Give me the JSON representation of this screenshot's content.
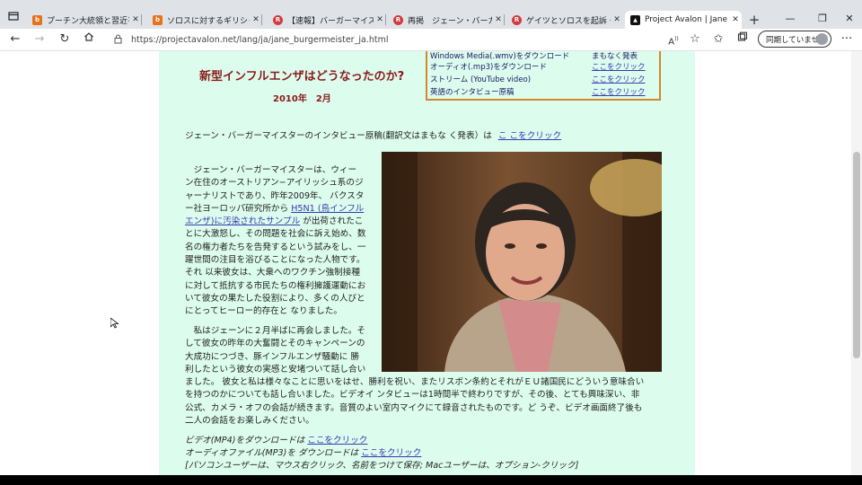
{
  "browser": {
    "tabs": [
      {
        "title": "プーチン大統領と習近平国家主",
        "favicon_color": "#e8711a",
        "favicon_glyph": "b"
      },
      {
        "title": "ソロスに対するギリシャ検察官の",
        "favicon_color": "#e8711a",
        "favicon_glyph": "b"
      },
      {
        "title": "【速報】バーガーマイスター、命取",
        "favicon_color": "#d33a3a",
        "favicon_glyph": "R"
      },
      {
        "title": "再掲　ジェーン・バーガーマイスタ",
        "favicon_color": "#d33a3a",
        "favicon_glyph": "R"
      },
      {
        "title": "ゲイツとソロスを起訴・有罪への",
        "favicon_color": "#d33a3a",
        "favicon_glyph": "R"
      },
      {
        "title": "Project Avalon | Jane Burger",
        "favicon_color": "#111111",
        "favicon_glyph": "▲"
      }
    ],
    "url": "https://projectavalon.net/lang/ja/jane_burgermeister_ja.html",
    "profile_label": "同期していません",
    "icons": [
      "tab-actions-icon",
      "back-icon",
      "forward-icon",
      "refresh-icon",
      "home-icon",
      "lock-icon",
      "read-aloud-icon",
      "favorite-add-icon",
      "favorites-icon",
      "collections-icon",
      "more-icon"
    ]
  },
  "page": {
    "headline": "新型インフルエンザはどうなったのか?",
    "date": "2010年　2月",
    "downloads": [
      {
        "label": "Windows Media(.wmv)をダウンロード",
        "action": "まもなく発表",
        "is_link": false
      },
      {
        "label": "オーディオ(.mp3)をダウンロード",
        "action": "ここをクリック",
        "is_link": true
      },
      {
        "label": "ストリーム (YouTube video)",
        "action": "ここをクリック",
        "is_link": true
      },
      {
        "label": "英語のインタビュー原稿",
        "action": "ここをクリック",
        "is_link": true
      }
    ],
    "transcript_line": "ジェーン・バーガーマイスターのインタビュー原稿(翻訳文はまもな く発表）は",
    "transcript_link": "こ こをクリック",
    "para1_lines": [
      "　ジェーン・バーガーマイスターは、ウィー",
      "ン在住のオーストリアン−アイリッシュ系のジ",
      "ャーナリストであり、昨年2009年、 バクスタ",
      "ー社ヨーロッパ研究所から"
    ],
    "para1_link_a": "H5N1 (鳥インフル",
    "para1_link_b": "エンザ)に汚染されたサンプル",
    "para1_after_link": "が出荷されたこ",
    "para1_rest": [
      "とに大激怒し、その問題を社会に訴え始め、数",
      "名の権力者たちを告発するという試みをし、一",
      "躍世間の注目を浴びることになった人物です。",
      "それ 以来彼女は、大衆へのワクチン強制接種",
      "に対して抵抗する市民たちの権利擁護運動にお",
      "いて彼女の果たした役割により、多くの人びと",
      "にとってヒーロー的存在と なりました。"
    ],
    "para2_lines": [
      "　私はジェーンに２月半ばに再会しました。そ",
      "して彼女の昨年の大奮闘とそのキャンペーンの",
      "大成功につづき、豚インフルエンザ騒動に 勝",
      "利したという彼女の実感と安堵ついて話し合い"
    ],
    "para2_wide": [
      "ました。 彼女と私は様々なことに思いをはせ、勝利を祝い、またリスボン条約とそれがＥＵ諸国民にどういう意味合い",
      "を持つのかについても話し合いました。ビデオイ ンタビューは1時間半で終わりですが、その後、とても興味深い、非",
      "公式、カメラ・オフの会話が続きます。音質のよい室内マイクにて録音されたものです。ど うぞ、ビデオ画面終了後も",
      "二人の会話をお楽しみください。"
    ],
    "video_dl_label": "ビデオ(MP4)をダウンロードは",
    "video_dl_link": "ここをクリック",
    "audio_dl_label": "オーディオファイル(MP3)を ダウンロードは",
    "audio_dl_link": " ここをクリック",
    "save_hint": "[パソコンユーザーは、マウス右クリック、名前をつけて保存; Macユーザーは、オプション-クリック]"
  },
  "colors": {
    "page_background": "#dcfcee",
    "headline": "#8b1a1a",
    "link": "#3a3ab0",
    "table_border": "#d4882b",
    "tab_bar": "#dfe3e8"
  }
}
